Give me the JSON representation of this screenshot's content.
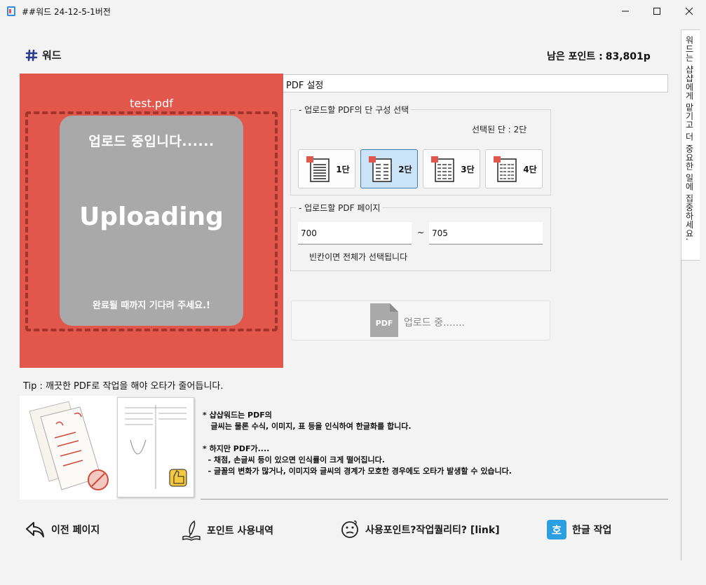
{
  "window": {
    "title": "##워드 24-12-5-1버전",
    "minimize_icon": "minimize-icon",
    "maximize_icon": "maximize-icon",
    "close_icon": "close-icon"
  },
  "header": {
    "brand": "워드",
    "points_label": "남은 포인트 :",
    "points_value": "83,801p"
  },
  "side_tab": {
    "text": "워드는 샵샵에게 맡기고 더 중요한 일에 집중하세요."
  },
  "upload": {
    "filename": "test.pdf",
    "status_top": "업로드 중입니다......",
    "status_big": "Uploading",
    "status_bottom": "완료될 때까지 기다려 주세요.!"
  },
  "settings": {
    "title": "PDF 설정",
    "columns": {
      "legend": "- 업로드할 PDF의 단 구성 선택",
      "selected_text": "선택된 단 : 2단",
      "options": [
        {
          "label": "1단",
          "selected": false
        },
        {
          "label": "2단",
          "selected": true
        },
        {
          "label": "3단",
          "selected": false
        },
        {
          "label": "4단",
          "selected": false
        }
      ]
    },
    "pages": {
      "legend": "- 업로드할 PDF 페이지",
      "from": "700",
      "separator": "~",
      "to": "705",
      "hint": "빈칸이면 전체가 선택됩니다"
    },
    "upload_button": {
      "icon_text": "PDF",
      "label": "업로드 중......."
    }
  },
  "tip": "Tip : 깨끗한 PDF로 작업을 해야 오타가 줄어듭니다.",
  "info": {
    "lines": [
      "* 샵샵워드는 PDF의",
      "   글씨는 물론 수식, 이미지, 표 등을 인식하여 한글화를 합니다.",
      "",
      "* 하지만 PDF가....",
      "  - 채점, 손글씨 등이 있으면 인식률이 크게 떨어집니다.",
      "  - 글꼴의 변화가 많거나, 이미지와 글씨의 경계가 모호한 경우에도 오타가 발생할 수 있습니다."
    ]
  },
  "nav": {
    "prev": "이전 페이지",
    "points_history": "포인트 사용내역",
    "quality": "사용포인트?작업퀄리티? [link]",
    "hangul": "한글 작업",
    "hangul_icon_text": "호"
  },
  "colors": {
    "upload_bg": "#e2574c",
    "card_bg": "#a9a9a9",
    "selected_btn": "#cce4f7",
    "hangul_icon": "#2b9fe0"
  }
}
